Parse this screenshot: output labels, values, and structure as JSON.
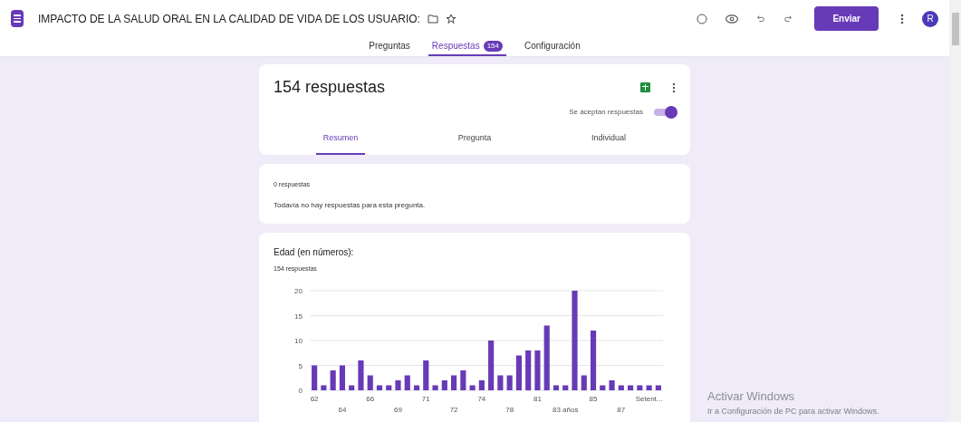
{
  "header": {
    "title": "IMPACTO DE LA SALUD ORAL EN LA CALIDAD DE VIDA DE LOS USUARIO:",
    "send_button": "Enviar",
    "avatar": "R"
  },
  "tabs": [
    {
      "label": "Preguntas",
      "selected": false
    },
    {
      "label": "Respuestas",
      "badge": "154",
      "selected": true
    },
    {
      "label": "Configuración",
      "selected": false
    }
  ],
  "summary_card": {
    "title": "154 respuestas",
    "accepting_label": "Se aceptan respuestas",
    "accepting": true,
    "subtabs": [
      {
        "label": "Resumen",
        "selected": true
      },
      {
        "label": "Pregunta",
        "selected": false
      },
      {
        "label": "Individual",
        "selected": false
      }
    ]
  },
  "empty_card": {
    "count": "0 respuestas",
    "message": "Todavía no hay respuestas para esta pregunta."
  },
  "chart_card": {
    "title": "Edad (en números):",
    "count": "154 respuestas",
    "chart_data": {
      "type": "bar",
      "values": [
        5,
        1,
        4,
        5,
        1,
        6,
        3,
        1,
        1,
        2,
        3,
        1,
        6,
        1,
        2,
        3,
        4,
        1,
        2,
        10,
        3,
        3,
        7,
        8,
        8,
        13,
        1,
        1,
        20,
        3,
        12,
        1,
        2,
        1,
        1,
        1,
        1,
        1
      ],
      "ylim": [
        0,
        20
      ],
      "yticks": [
        0,
        5,
        10,
        15,
        20
      ],
      "grid": true,
      "categories": [
        "62",
        null,
        null,
        "64",
        null,
        null,
        "66",
        null,
        null,
        "69",
        null,
        null,
        "71",
        null,
        null,
        "72",
        null,
        null,
        "74",
        null,
        null,
        "78",
        null,
        null,
        "81",
        null,
        null,
        "83 años",
        null,
        null,
        "85",
        null,
        null,
        "87",
        null,
        null,
        "Setent...",
        null
      ]
    }
  },
  "os_notice": {
    "title": "Activar Windows",
    "message": "Ir a Configuración de PC para activar Windows."
  }
}
